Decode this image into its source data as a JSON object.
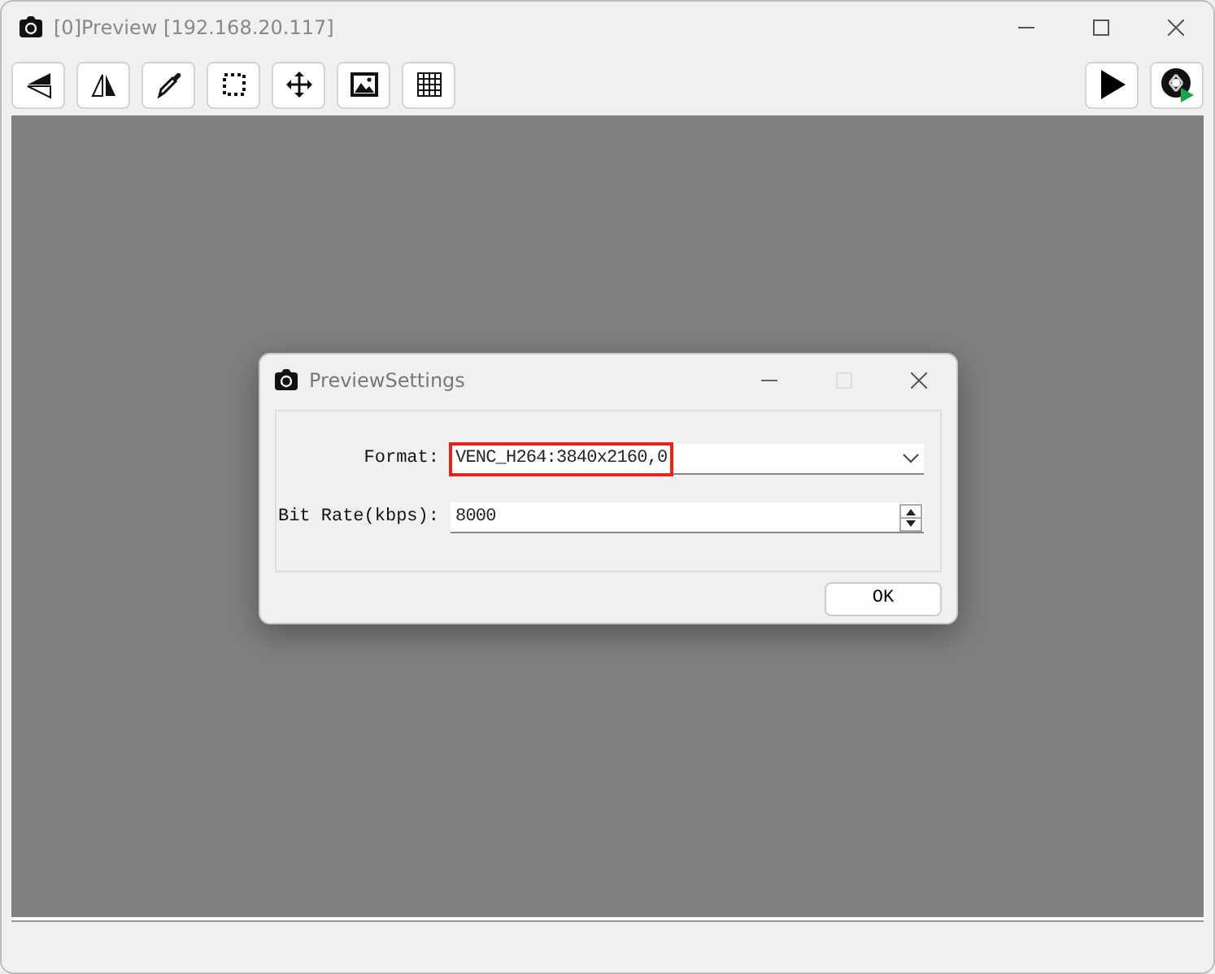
{
  "window": {
    "title": "[0]Preview [192.168.20.117]"
  },
  "dialog": {
    "title": "PreviewSettings",
    "fields": [
      {
        "kind": "select",
        "label": "Format:",
        "value": "VENC_H264:3840x2160,0",
        "highlighted": true
      },
      {
        "kind": "spinbox",
        "label": "Bit Rate(kbps):",
        "value": "8000",
        "highlighted": false
      }
    ],
    "buttons": [
      "OK"
    ]
  }
}
